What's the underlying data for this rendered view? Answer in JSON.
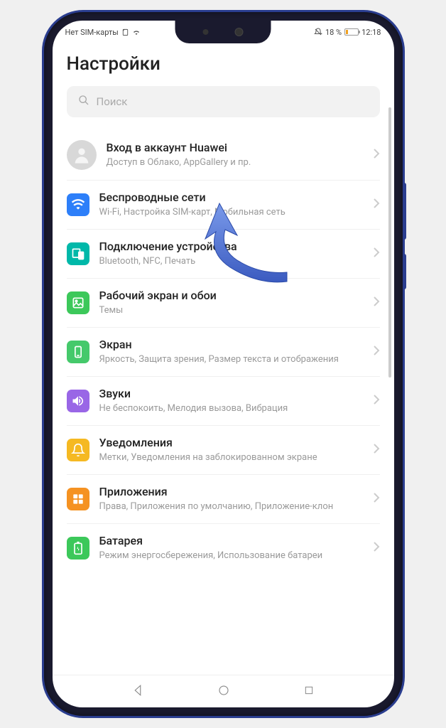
{
  "status": {
    "left_text": "Нет SIM-карты",
    "battery_pct": "18 %",
    "time": "12:18"
  },
  "page_title": "Настройки",
  "search": {
    "placeholder": "Поиск"
  },
  "account": {
    "title": "Вход в аккаунт Huawei",
    "sub": "Доступ в Облако, AppGallery и пр."
  },
  "items": [
    {
      "title": "Беспроводные сети",
      "sub": "Wi-Fi, Настройка SIM-карт, Мобильная сеть",
      "icon": "wifi-icon",
      "color": "ic-blue"
    },
    {
      "title": "Подключение устройства",
      "sub": "Bluetooth, NFC, Печать",
      "icon": "device-connect-icon",
      "color": "ic-teal"
    },
    {
      "title": "Рабочий экран и обои",
      "sub": "Темы",
      "icon": "wallpaper-icon",
      "color": "ic-green"
    },
    {
      "title": "Экран",
      "sub": "Яркость, Защита зрения, Размер текста и отображения",
      "icon": "display-icon",
      "color": "ic-grn2"
    },
    {
      "title": "Звуки",
      "sub": "Не беспокоить, Мелодия вызова, Вибрация",
      "icon": "sound-icon",
      "color": "ic-purple"
    },
    {
      "title": "Уведомления",
      "sub": "Метки, Уведомления на заблокированном экране",
      "icon": "bell-icon",
      "color": "ic-yellow"
    },
    {
      "title": "Приложения",
      "sub": "Права, Приложения по умолчанию, Приложение-клон",
      "icon": "apps-icon",
      "color": "ic-orange"
    },
    {
      "title": "Батарея",
      "sub": "Режим энергосбережения, Использование батареи",
      "icon": "battery-icon",
      "color": "ic-grn3"
    }
  ],
  "colors": {
    "accent_blue": "#2d7ff9",
    "arrow": "#4a6cd4"
  }
}
